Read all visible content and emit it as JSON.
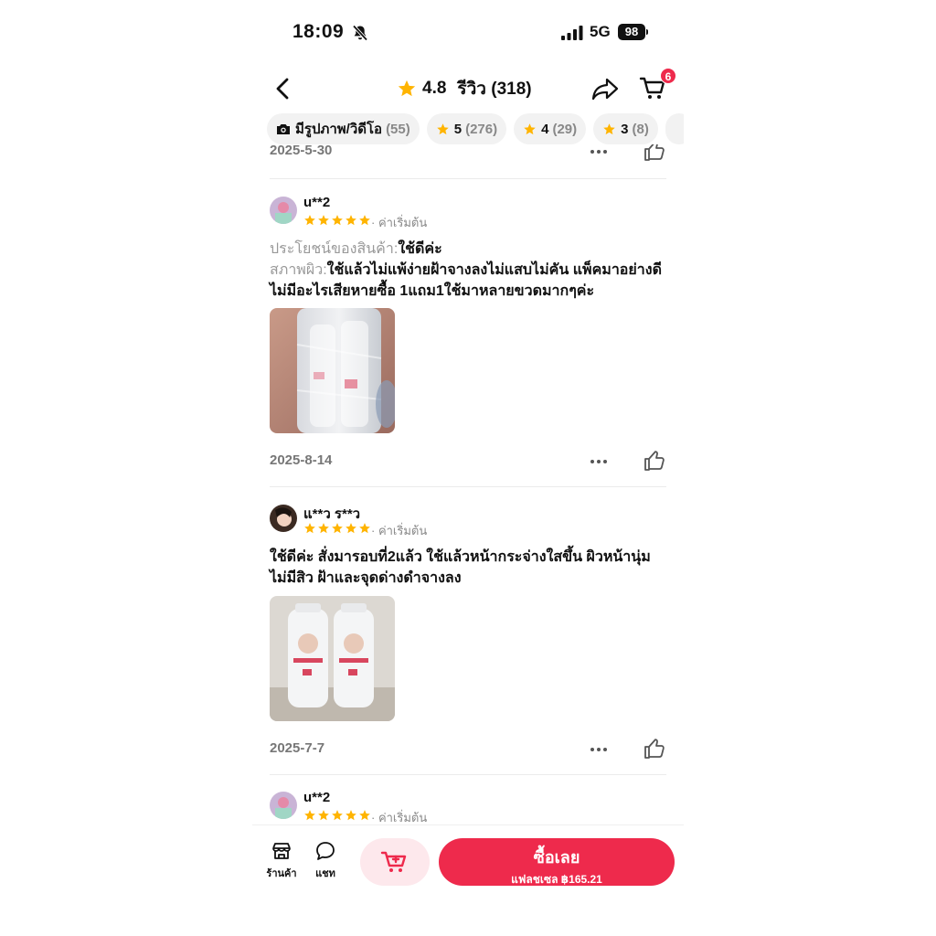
{
  "status_bar": {
    "time": "18:09",
    "network": "5G",
    "battery": "98"
  },
  "header": {
    "rating": "4.8",
    "reviews_label": "รีวิว (318)",
    "cart_count": "6"
  },
  "filters": [
    {
      "label": "มีรูปภาพ/วิดีโอ",
      "count": "(55)"
    },
    {
      "label": "5",
      "count": "(276)"
    },
    {
      "label": "4",
      "count": "(29)"
    },
    {
      "label": "3",
      "count": "(8)"
    }
  ],
  "prev_review": {
    "date": "2025-5-30"
  },
  "reviews": [
    {
      "user": "u**2",
      "stars": 5,
      "variant": "· ค่าเริ่มต้น",
      "benefit_label": "ประโยชน์ของสินค้า:",
      "benefit_text": "ใช้ดีค่ะ",
      "skin_label": "สภาพผิว:",
      "skin_text": "ใช้แล้วไม่แพ้ง่ายฝ้าจางลงไม่แสบไม่คัน แพ็คมาอย่างดีไม่มีอะไรเสียหายซื้อ 1แถม1ใช้มาหลายขวดมากๆค่ะ",
      "date": "2025-8-14"
    },
    {
      "user": "แ**ว ร**ว",
      "stars": 5,
      "variant": "· ค่าเริ่มต้น",
      "text": "ใช้ดีค่ะ สั่งมารอบที่2แล้ว ใช้แล้วหน้ากระจ่างใสขึ้น ผิวหน้านุ่ม ไม่มีสิว ฝ้าและจุดด่างดำจางลง",
      "date": "2025-7-7"
    },
    {
      "user": "u**2",
      "stars": 5,
      "variant": "· ค่าเริ่มต้น"
    }
  ],
  "bottom_bar": {
    "shop_label": "ร้านค้า",
    "chat_label": "แชท",
    "buy_label": "ซื้อเลย",
    "buy_sub": "แฟลชเซล ฿165.21"
  },
  "colors": {
    "accent": "#ee2a4c",
    "star": "#ffb400"
  }
}
